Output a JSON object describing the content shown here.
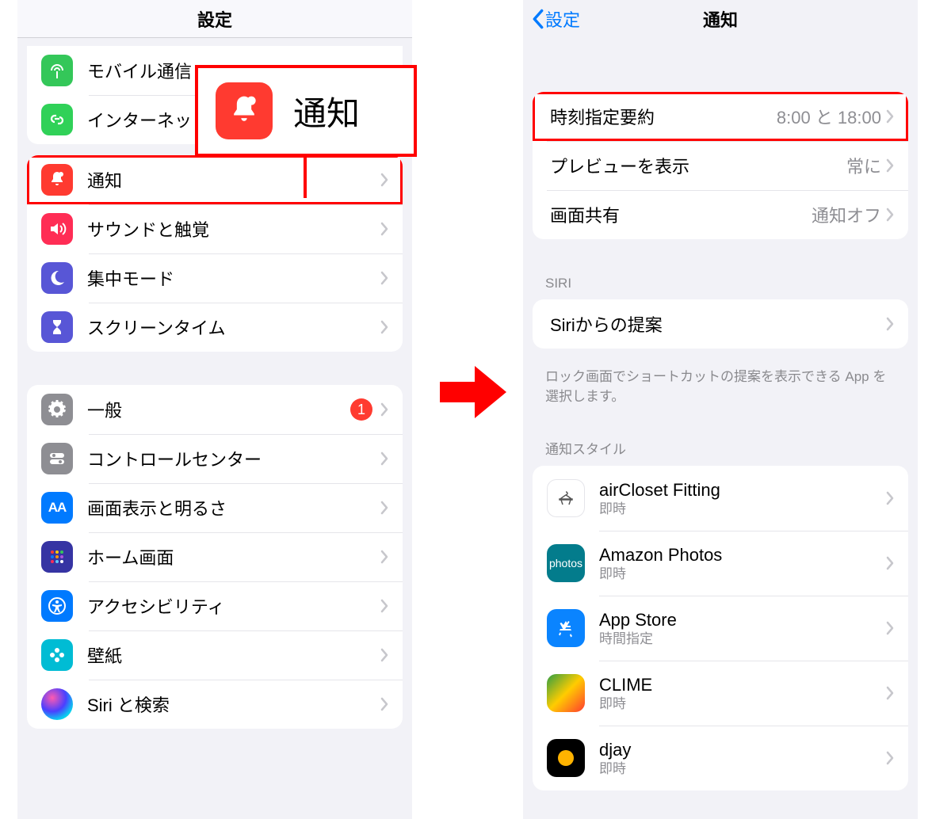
{
  "left": {
    "nav_title": "設定",
    "rows_group1": [
      {
        "id": "mobile",
        "label": "モバイル通信",
        "icon": "antenna-icon"
      },
      {
        "id": "tether",
        "label": "インターネット共有",
        "icon": "link-icon"
      }
    ],
    "rows_group2": [
      {
        "id": "notifications",
        "label": "通知",
        "icon": "bell-icon",
        "highlight": true
      },
      {
        "id": "sounds",
        "label": "サウンドと触覚",
        "icon": "speaker-icon"
      },
      {
        "id": "focus",
        "label": "集中モード",
        "icon": "moon-icon"
      },
      {
        "id": "screentime",
        "label": "スクリーンタイム",
        "icon": "hourglass-icon"
      }
    ],
    "rows_group3": [
      {
        "id": "general",
        "label": "一般",
        "icon": "gear-icon",
        "badge": "1"
      },
      {
        "id": "controlcenter",
        "label": "コントロールセンター",
        "icon": "toggles-icon"
      },
      {
        "id": "display",
        "label": "画面表示と明るさ",
        "icon": "aa-icon"
      },
      {
        "id": "home",
        "label": "ホーム画面",
        "icon": "grid-icon"
      },
      {
        "id": "accessibility",
        "label": "アクセシビリティ",
        "icon": "accessibility-icon"
      },
      {
        "id": "wallpaper",
        "label": "壁紙",
        "icon": "flower-icon"
      },
      {
        "id": "siri",
        "label": "Siri と検索",
        "icon": "siri-icon"
      }
    ]
  },
  "right": {
    "nav_back": "設定",
    "nav_title": "通知",
    "rows_group1": [
      {
        "id": "scheduled",
        "label": "時刻指定要約",
        "value": "8:00 と 18:00",
        "highlight": true
      },
      {
        "id": "preview",
        "label": "プレビューを表示",
        "value": "常に"
      },
      {
        "id": "share",
        "label": "画面共有",
        "value": "通知オフ"
      }
    ],
    "siri_section_header": "SIRI",
    "rows_group2": [
      {
        "id": "siri-suggest",
        "label": "Siriからの提案"
      }
    ],
    "siri_footer": "ロック画面でショートカットの提案を表示できる App を選択します。",
    "style_section_header": "通知スタイル",
    "apps": [
      {
        "id": "aircloset",
        "name": "airCloset Fitting",
        "sub": "即時",
        "icon": "app-aircloset"
      },
      {
        "id": "amazon",
        "name": "Amazon Photos",
        "sub": "即時",
        "icon": "app-photos"
      },
      {
        "id": "appstore",
        "name": "App Store",
        "sub": "時間指定",
        "icon": "app-appstore"
      },
      {
        "id": "clime",
        "name": "CLIME",
        "sub": "即時",
        "icon": "app-clime"
      },
      {
        "id": "djay",
        "name": "djay",
        "sub": "即時",
        "icon": "app-djay"
      }
    ]
  },
  "callout": {
    "label": "通知"
  }
}
